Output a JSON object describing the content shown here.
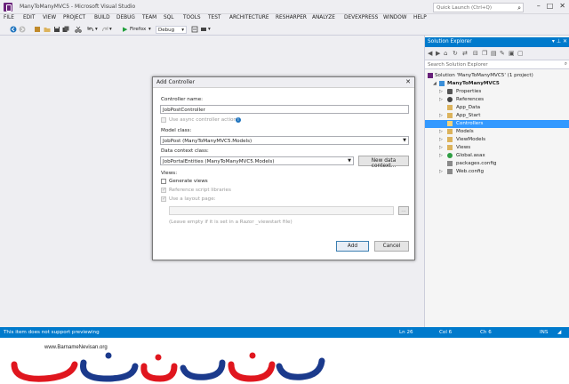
{
  "window": {
    "title": "ManyToManyMVC5 - Microsoft Visual Studio",
    "quick_launch_placeholder": "Quick Launch (Ctrl+Q)"
  },
  "menu": [
    "FILE",
    "EDIT",
    "VIEW",
    "PROJECT",
    "BUILD",
    "DEBUG",
    "TEAM",
    "SQL",
    "TOOLS",
    "TEST",
    "ARCHITECTURE",
    "RESHARPER",
    "ANALYZE",
    "DEVEXPRESS",
    "WINDOW",
    "HELP"
  ],
  "toolbar": {
    "browser": "Firefox",
    "configuration": "Debug"
  },
  "dialog": {
    "title": "Add Controller",
    "controller_name_label": "Controller name:",
    "controller_name_value": "JobPostController",
    "async_label": "Use async controller actions",
    "model_class_label": "Model class:",
    "model_class_value": "JobPost (ManyToManyMVC5.Models)",
    "data_context_label": "Data context class:",
    "data_context_value": "JobPortalEntities (ManyToManyMVC5.Models)",
    "new_data_context_button": "New data context...",
    "views_label": "Views:",
    "generate_views_label": "Generate views",
    "reference_scripts_label": "Reference script libraries",
    "layout_page_label": "Use a layout page:",
    "layout_hint": "(Leave empty if it is set in a Razor _viewstart file)",
    "browse_button": "...",
    "add_button": "Add",
    "cancel_button": "Cancel"
  },
  "solution_explorer": {
    "title": "Solution Explorer",
    "search_placeholder": "Search Solution Explorer",
    "items": [
      {
        "label": "Solution 'ManyToManyMVC5' (1 project)"
      },
      {
        "label": "ManyToManyMVC5"
      },
      {
        "label": "Properties"
      },
      {
        "label": "References"
      },
      {
        "label": "App_Data"
      },
      {
        "label": "App_Start"
      },
      {
        "label": "Controllers"
      },
      {
        "label": "Models"
      },
      {
        "label": "ViewModels"
      },
      {
        "label": "Views"
      },
      {
        "label": "Global.asax"
      },
      {
        "label": "packages.config"
      },
      {
        "label": "Web.config"
      }
    ]
  },
  "status": {
    "message": "This item does not support previewing",
    "ln": "Ln 26",
    "col": "Col 6",
    "ch": "Ch 6",
    "mode": "INS"
  },
  "watermark": {
    "url": "www.BarnameNevisan.org",
    "logo_text": "برنامه نویسان"
  },
  "colors": {
    "accent": "#007acc",
    "selection": "#3399ff",
    "logo_red": "#e0161e",
    "logo_blue": "#1b3a8c"
  }
}
